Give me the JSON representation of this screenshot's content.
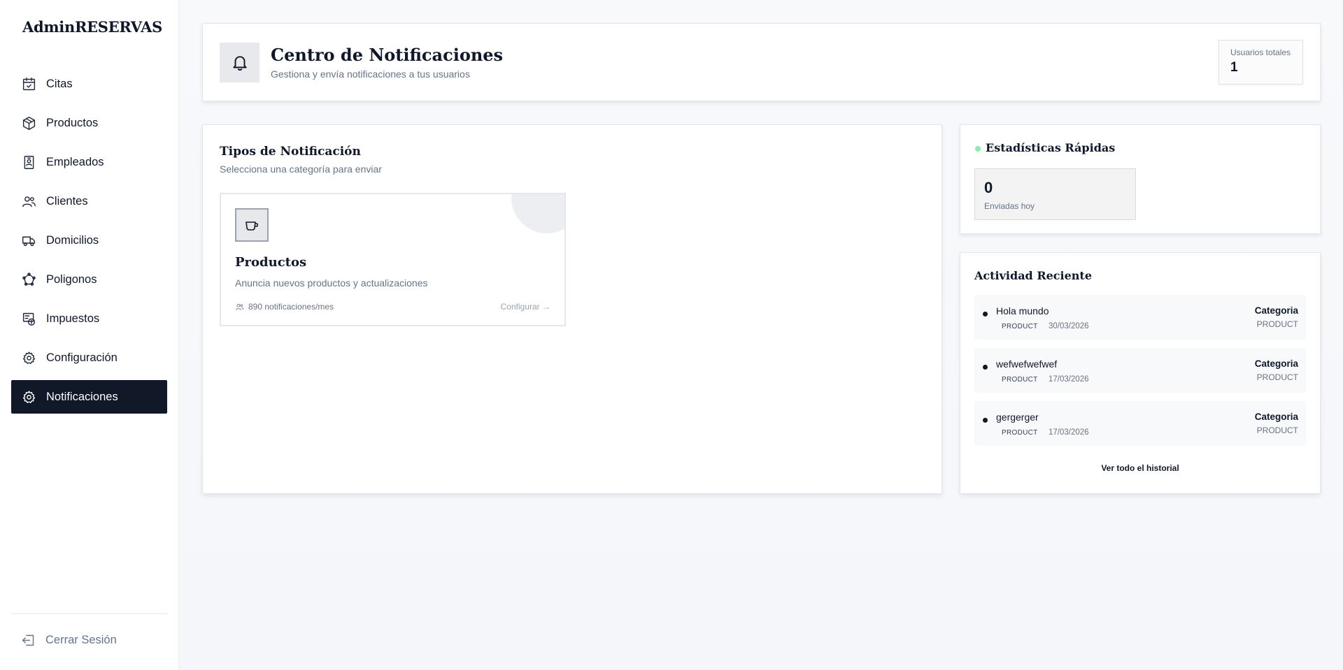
{
  "sidebar": {
    "brand": "AdminRESERVAS",
    "items": [
      {
        "label": "Citas",
        "icon": "calendar-check-icon"
      },
      {
        "label": "Productos",
        "icon": "package-icon"
      },
      {
        "label": "Empleados",
        "icon": "id-badge-icon"
      },
      {
        "label": "Clientes",
        "icon": "users-icon"
      },
      {
        "label": "Domicilios",
        "icon": "truck-icon"
      },
      {
        "label": "Poligonos",
        "icon": "polygon-icon"
      },
      {
        "label": "Impuestos",
        "icon": "tax-icon"
      },
      {
        "label": "Configuración",
        "icon": "gear-icon"
      },
      {
        "label": "Notificaciones",
        "icon": "gear-icon",
        "active": true
      }
    ],
    "logout_label": "Cerrar Sesión"
  },
  "header": {
    "title": "Centro de Notificaciones",
    "subtitle": "Gestiona y envía notificaciones a tus usuarios",
    "users_label": "Usuarios totales",
    "users_value": "1"
  },
  "tipos": {
    "title": "Tipos de Notificación",
    "subtitle": "Selecciona una categoría para enviar",
    "cards": [
      {
        "title": "Productos",
        "description": "Anuncia nuevos productos y actualizaciones",
        "meta": "890 notificaciones/mes",
        "action": "Configurar →"
      }
    ]
  },
  "stats": {
    "title": "Estadísticas Rápidas",
    "value": "0",
    "label": "Enviadas hoy"
  },
  "activity": {
    "title": "Actividad Reciente",
    "items": [
      {
        "title": "Hola mundo",
        "tag": "PRODUCT",
        "date": "30/03/2026",
        "category": "Categoria",
        "category_sub": "PRODUCT"
      },
      {
        "title": "wefwefwefwef",
        "tag": "PRODUCT",
        "date": "17/03/2026",
        "category": "Categoria",
        "category_sub": "PRODUCT"
      },
      {
        "title": "gergerger",
        "tag": "PRODUCT",
        "date": "17/03/2026",
        "category": "Categoria",
        "category_sub": "PRODUCT"
      }
    ],
    "more_label": "Ver todo el historial"
  },
  "colors": {
    "accent_dark": "#111827",
    "status_dot": "#86efac",
    "muted_text": "#64748b"
  }
}
